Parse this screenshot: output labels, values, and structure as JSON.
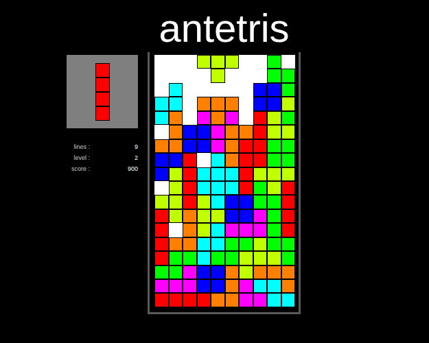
{
  "title": "antetris",
  "next": {
    "color": "#ff0000",
    "cells": 4
  },
  "stats": [
    {
      "label": "lines :",
      "value": "9"
    },
    {
      "label": "level :",
      "value": "2"
    },
    {
      "label": "score :",
      "value": "900"
    }
  ],
  "palette": {
    ".": "#ffffff",
    "R": "#ff0000",
    "O": "#ff8000",
    "C": "#00ffff",
    "B": "#0000ff",
    "M": "#ff00ff",
    "G": "#00ff00",
    "L": "#bfff00"
  },
  "board": {
    "rows": [
      [
        ".",
        ".",
        ".",
        "L",
        "L",
        "L",
        ".",
        ".",
        "G",
        "."
      ],
      [
        ".",
        ".",
        ".",
        ".",
        "L",
        ".",
        ".",
        ".",
        "G",
        "G"
      ],
      [
        ".",
        "C",
        ".",
        ".",
        ".",
        ".",
        ".",
        "B",
        "B",
        "G"
      ],
      [
        "C",
        "C",
        ".",
        "O",
        "O",
        "O",
        ".",
        "B",
        "B",
        "L"
      ],
      [
        "C",
        "O",
        ".",
        "M",
        "O",
        "M",
        ".",
        "R",
        "L",
        "G"
      ],
      [
        ".",
        "O",
        "B",
        "B",
        "M",
        "O",
        "O",
        "R",
        "L",
        "L"
      ],
      [
        "O",
        "O",
        "B",
        "B",
        "M",
        "O",
        "R",
        "R",
        "G",
        "G"
      ],
      [
        "B",
        "B",
        "R",
        ".",
        "C",
        "O",
        "R",
        "R",
        "G",
        "G"
      ],
      [
        "B",
        "L",
        "R",
        "C",
        "C",
        "C",
        "R",
        "L",
        "L",
        "L"
      ],
      [
        ".",
        "L",
        "R",
        "C",
        "C",
        "C",
        "R",
        "G",
        "L",
        "R"
      ],
      [
        "L",
        "L",
        "R",
        "L",
        "C",
        "B",
        "B",
        "G",
        "G",
        "R"
      ],
      [
        "R",
        "L",
        "O",
        "L",
        "L",
        "B",
        "B",
        "M",
        "G",
        "R"
      ],
      [
        "R",
        ".",
        "O",
        "L",
        "C",
        "M",
        "M",
        "M",
        "G",
        "R"
      ],
      [
        "R",
        "O",
        "O",
        "C",
        "C",
        "G",
        "G",
        "L",
        "G",
        "G"
      ],
      [
        "R",
        "G",
        "G",
        "C",
        "G",
        "G",
        "L",
        "L",
        "L",
        "G"
      ],
      [
        "G",
        "G",
        "M",
        "B",
        "B",
        "O",
        "L",
        "O",
        "O",
        "O"
      ],
      [
        "M",
        "M",
        "M",
        "B",
        "B",
        "O",
        "M",
        "C",
        "C",
        "O"
      ],
      [
        "R",
        "R",
        "R",
        "R",
        "O",
        "O",
        "M",
        "M",
        "C",
        "C"
      ]
    ]
  }
}
